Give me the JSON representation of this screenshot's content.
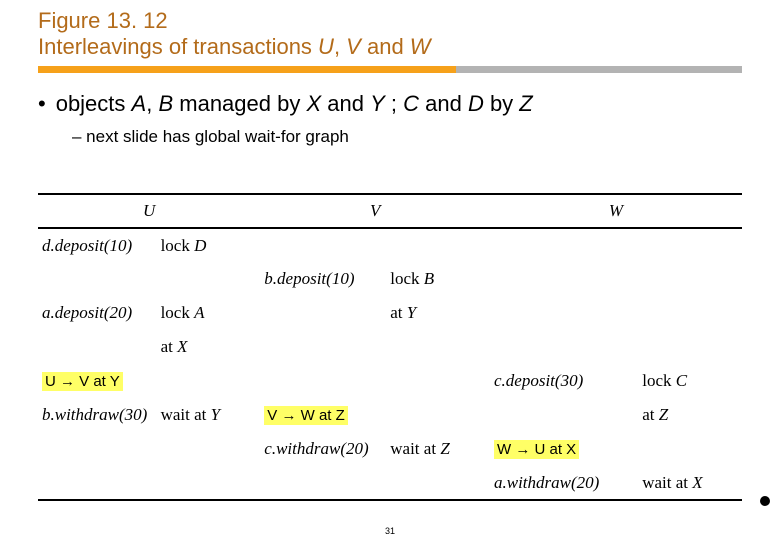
{
  "header": {
    "figure_number": "Figure 13. 12",
    "title_pre": "Interleavings of transactions ",
    "title_u": "U",
    "title_sep1": ", ",
    "title_v": "V",
    "title_and": " and ",
    "title_w": "W"
  },
  "bullets": {
    "main_pre": "objects ",
    "main_a": "A",
    "main_c1": ", ",
    "main_b": "B",
    "main_mid": " managed by ",
    "main_x": "X",
    "main_and1": " and ",
    "main_y": "Y",
    "main_sc": " ;  ",
    "main_c": "C",
    "main_and2": " and ",
    "main_d": "D",
    "main_by": " by ",
    "main_z": "Z",
    "sub": "– next slide has global wait-for graph"
  },
  "table": {
    "headers": {
      "u": "U",
      "v": "V",
      "w": "W"
    },
    "rows": [
      {
        "c0": "d.deposit(10)",
        "c1_pre": "lock ",
        "c1_obj": "D",
        "c2": "",
        "c3": "",
        "c4": "",
        "c5": ""
      },
      {
        "c0": "",
        "c1": "",
        "c2": "b.deposit(10)",
        "c3_pre": "lock ",
        "c3_obj": "B",
        "c4": "",
        "c5": ""
      },
      {
        "c0": "a.deposit(20)",
        "c1_pre": "lock ",
        "c1_obj": "A",
        "c2": "",
        "c3_pre": "at ",
        "c3_obj": "Y",
        "c4": "",
        "c5": ""
      },
      {
        "c0": "",
        "c1_pre": "at ",
        "c1_obj": "X",
        "c2": "",
        "c3": "",
        "c4": "",
        "c5": ""
      },
      {
        "c0_hl": "U → V at Y",
        "c1": "",
        "c2": "",
        "c3": "",
        "c4": "c.deposit(30)",
        "c5_pre": "lock ",
        "c5_obj": "C"
      },
      {
        "c0": "b.withdraw(30)",
        "c1_pre": "wait at  ",
        "c1_obj": "Y",
        "c2_hl": "V → W at Z",
        "c3": "",
        "c4": "",
        "c5_pre": "at ",
        "c5_obj": "Z"
      },
      {
        "c0": "",
        "c1": "",
        "c2": "c.withdraw(20)",
        "c3_pre": "wait at  ",
        "c3_obj": "Z",
        "c4_hl": "W → U at X",
        "c5": ""
      },
      {
        "c0": "",
        "c1": "",
        "c2": "",
        "c3": "",
        "c4": "a.withdraw(20)",
        "c5_pre": "wait at  ",
        "c5_obj": "X"
      }
    ]
  },
  "page_number": "31"
}
